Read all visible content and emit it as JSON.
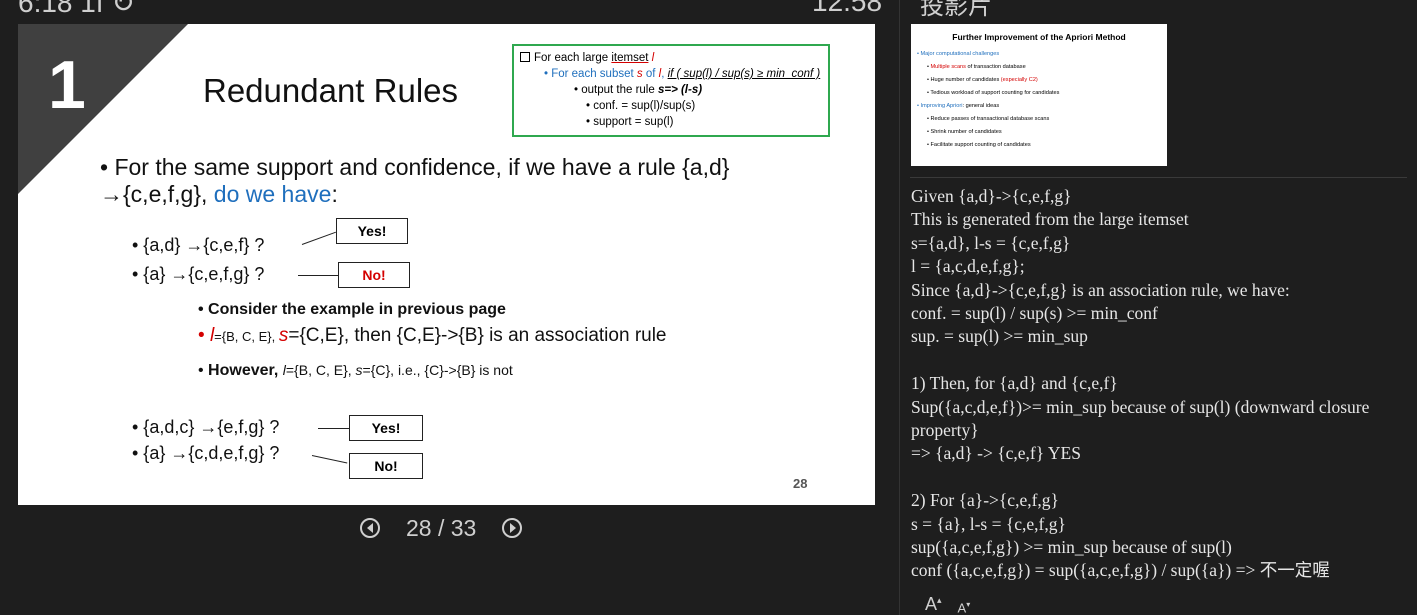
{
  "status": {
    "left": "6:18 1f ↻",
    "clock": "12:58"
  },
  "slide": {
    "number": "1",
    "title": "Redundant Rules",
    "rulebox": {
      "line1_a": "For each large ",
      "line1_b": "itemset",
      "line1_c": " l",
      "line2_a": "• For each subset ",
      "line2_b": "s",
      "line2_c": " of ",
      "line2_d": "l",
      "line2_e": ", ",
      "line2_f": "if ( sup(l) / sup(s) ≥ min_conf )",
      "line3_a": "• output the rule ",
      "line3_b": "s=> (l-s)",
      "line4": "• conf. = sup(l)/sup(s)",
      "line5": "• support = sup(l)"
    },
    "main_bullet_a": "• For the same support and confidence, if we have a rule {a,d} →{c,e,f,g}, ",
    "main_bullet_b": "do we have",
    "main_bullet_c": ":",
    "q1": "• {a,d} →{c,e,f} ?",
    "q1_answer": "Yes!",
    "q2": "• {a} →{c,e,f,g} ?",
    "q2_answer": "No!",
    "consider": "Consider the example in previous page",
    "ex1_a": "l",
    "ex1_b": "={B, C, E}, ",
    "ex1_c": "s",
    "ex1_d": "={C,E}, then {C,E}->{B} is an association rule",
    "ex2_a": "However, ",
    "ex2_b": "l",
    "ex2_c": "={B, C, E}, ",
    "ex2_d": "s",
    "ex2_e": "={C}, i.e., {C}->{B} is not",
    "q3": "• {a,d,c} →{e,f,g} ?",
    "q3_answer": "Yes!",
    "q4": "• {a} →{c,d,e,f,g} ?",
    "q4_answer": "No!",
    "page": "28"
  },
  "pager": {
    "current": "28",
    "separator": " / ",
    "total": "33"
  },
  "panel": {
    "title": "投影片",
    "thumbnail": {
      "title": "Further Improvement of the Apriori Method",
      "lines": [
        "• Major computational challenges",
        "Multiple scans",
        " of transaction database",
        "• Huge number of candidates ",
        "(especially C2)",
        "• Tedious workload of support counting for candidates",
        "• Improving Apriori",
        ": general ideas",
        "• Reduce passes of transactional database scans",
        "• Shrink number of candidates",
        "• Facilitate support counting of candidates"
      ]
    },
    "notes": [
      "Given {a,d}->{c,e,f,g}",
      "This is generated from the large itemset",
      "s={a,d}, l-s = {c,e,f,g}",
      "l = {a,c,d,e,f,g};",
      "Since {a,d}->{c,e,f,g} is an association rule, we have:",
      "conf. = sup(l) / sup(s) >= min_conf",
      "sup. = sup(l) >= min_sup",
      "",
      "1) Then, for {a,d} and {c,e,f}",
      "Sup({a,c,d,e,f})>= min_sup because of sup(l) (downward closure property}",
      "=> {a,d} -> {c,e,f} YES",
      "",
      "2) For {a}->{c,e,f,g}",
      "s = {a}, l-s = {c,e,f,g}",
      "sup({a,c,e,f,g}) >= min_sup because of sup(l)",
      "conf ({a,c,e,f,g}) = sup({a,c,e,f,g}) / sup({a}) => 不一定喔"
    ],
    "font_larger": "A",
    "font_smaller": "A"
  }
}
